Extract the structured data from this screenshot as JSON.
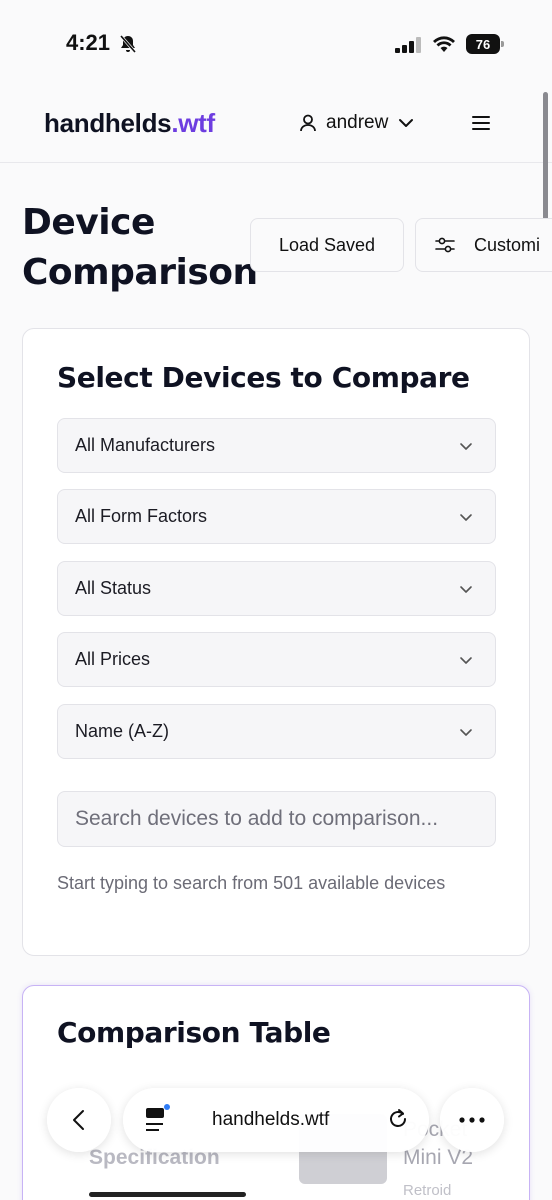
{
  "status": {
    "time": "4:21",
    "battery": "76"
  },
  "header": {
    "logo_main": "handhelds",
    "logo_accent": ".wtf",
    "username": "andrew"
  },
  "page": {
    "title": "Device Comparison",
    "load_saved_label": "Load Saved",
    "customize_label": "Customi"
  },
  "selector": {
    "title": "Select Devices to Compare",
    "filters": [
      {
        "value": "All Manufacturers"
      },
      {
        "value": "All Form Factors"
      },
      {
        "value": "All Status"
      },
      {
        "value": "All Prices"
      },
      {
        "value": "Name (A-Z)"
      }
    ],
    "search_placeholder": "Search devices to add to comparison...",
    "help_text": "Start typing to search from 501 available devices"
  },
  "comparison": {
    "title": "Comparison Table",
    "spec_header": "Specification",
    "device_name": "Pocket Mini V2",
    "device_brand": "Retroid"
  },
  "browser": {
    "url": "handhelds.wtf"
  },
  "icons": [
    "bell-slash-icon",
    "signal-icon",
    "wifi-icon",
    "user-icon",
    "chevron-down-icon",
    "hamburger-icon",
    "sliders-icon",
    "back-icon",
    "tab-icon",
    "reload-icon",
    "more-icon"
  ],
  "colors": {
    "accent": "#6d3de0",
    "text": "#0f1222",
    "muted": "#6b6b76",
    "border": "#e3e3e8"
  }
}
